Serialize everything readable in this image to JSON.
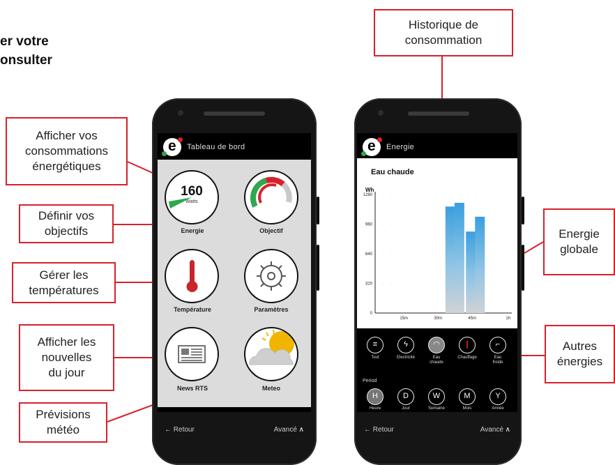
{
  "heading": "er votre\nonsulter",
  "callouts": {
    "afficher_conso": "Afficher vos\nconsommations\nénergétiques",
    "definir_objectifs": "Définir vos\nobjectifs",
    "gerer_temperatures": "Gérer les\ntempératures",
    "afficher_nouvelles": "Afficher les\nnouvelles\ndu jour",
    "previsions_meteo": "Prévisions\nmétéo",
    "historique": "Historique de\nconsommation",
    "energie_globale": "Energie\nglobale",
    "autres_energies": "Autres\nénergies"
  },
  "phone1": {
    "title": "Tableau de bord",
    "tiles": {
      "energie": {
        "label": "Energie",
        "value": "160",
        "unit": "Watts"
      },
      "objectif": {
        "label": "Objectif"
      },
      "temperature": {
        "label": "Température"
      },
      "parametres": {
        "label": "Paramètres"
      },
      "news": {
        "label": "News RTS"
      },
      "meteo": {
        "label": "Meteo"
      }
    },
    "back": "Retour",
    "advanced": "Avancé"
  },
  "phone2": {
    "title": "Energie",
    "chart_title": "Eau chaude",
    "energy_types": [
      {
        "label": "Tout"
      },
      {
        "label": "Electricité"
      },
      {
        "label": "Eau\nchaude"
      },
      {
        "label": "Chauffage"
      },
      {
        "label": "Eau\nfroide"
      }
    ],
    "period_label": "Period",
    "periods": [
      {
        "letter": "H",
        "label": "Heure"
      },
      {
        "letter": "D",
        "label": "Jour"
      },
      {
        "letter": "W",
        "label": "Semaine"
      },
      {
        "letter": "M",
        "label": "Mois"
      },
      {
        "letter": "Y",
        "label": "Année"
      }
    ],
    "back": "Retour",
    "advanced": "Avancé"
  },
  "colors": {
    "accent": "#d8202b",
    "bar": "#3a9fde",
    "green": "#2fa84f",
    "hot": "#c9252c"
  },
  "chart_data": {
    "type": "bar",
    "title": "Eau chaude",
    "ylabel": "Wh",
    "xlabel": "",
    "ylim": [
      0,
      1280
    ],
    "yticks": [
      0,
      320,
      640,
      960,
      1280
    ],
    "xticks": [
      "15m",
      "30m",
      "45m",
      "1h"
    ],
    "xlim": [
      0,
      60
    ],
    "series": [
      {
        "x": [
          33,
          37,
          42,
          46
        ],
        "values": [
          1150,
          1190,
          880,
          1040
        ]
      }
    ]
  }
}
